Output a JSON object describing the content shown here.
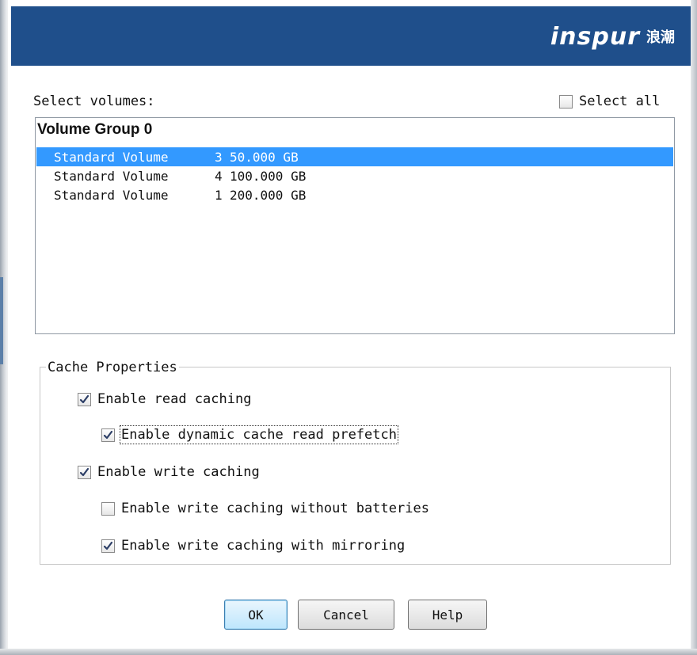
{
  "brand": {
    "logo_text": "inspur",
    "logo_cn": "浪潮"
  },
  "volumes": {
    "label": "Select volumes:",
    "select_all": {
      "label": "Select all",
      "checked": false
    },
    "group_name": "Volume Group 0",
    "rows": [
      {
        "name": "Standard Volume",
        "number": "3",
        "size": "50.000 GB",
        "selected": true
      },
      {
        "name": "Standard Volume",
        "number": "4",
        "size": "100.000 GB",
        "selected": false
      },
      {
        "name": "Standard Volume",
        "number": "1",
        "size": "200.000 GB",
        "selected": false
      }
    ]
  },
  "cache": {
    "title": "Cache Properties",
    "options": [
      {
        "label": "Enable read caching",
        "checked": true,
        "enabled": false,
        "focused": false
      },
      {
        "label": "Enable dynamic cache read prefetch",
        "checked": true,
        "enabled": true,
        "focused": true
      },
      {
        "label": "Enable write caching",
        "checked": true,
        "enabled": false,
        "focused": false
      },
      {
        "label": "Enable write caching without batteries",
        "checked": false,
        "enabled": false,
        "focused": false
      },
      {
        "label": "Enable write caching with mirroring",
        "checked": true,
        "enabled": false,
        "focused": false
      }
    ]
  },
  "buttons": {
    "ok": "OK",
    "cancel": "Cancel",
    "help": "Help"
  },
  "colors": {
    "banner": "#1f4f8b",
    "selection": "#3399ff"
  }
}
